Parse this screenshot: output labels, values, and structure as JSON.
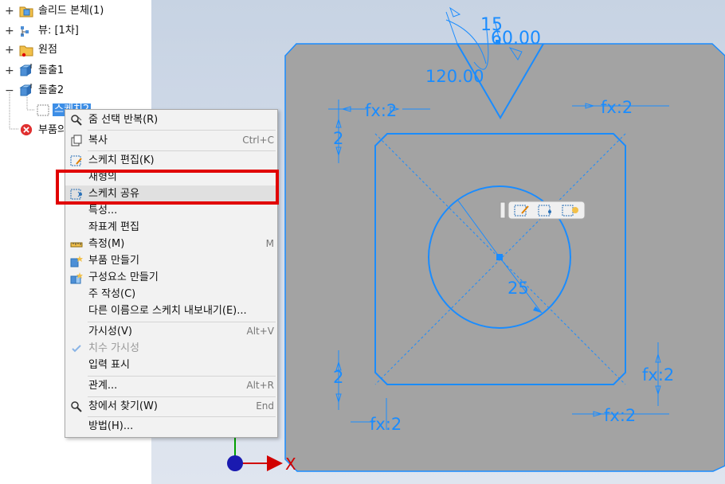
{
  "tree": {
    "items": [
      {
        "label": "솔리드 본체(1)",
        "expander": "+"
      },
      {
        "label": "뷰: [1차]",
        "expander": "+"
      },
      {
        "label": "원점",
        "expander": "+"
      },
      {
        "label": "돌출1",
        "expander": "+"
      },
      {
        "label": "돌출2",
        "expander": "−"
      },
      {
        "label": "스케치2",
        "expander": ""
      },
      {
        "label": "부품의 끝",
        "expander": ""
      }
    ]
  },
  "context_menu": {
    "items": [
      {
        "label": "줌 선택 반복(R)",
        "shortcut": "",
        "icon": "zoom-select-icon"
      },
      {
        "label": "복사",
        "shortcut": "Ctrl+C",
        "icon": "copy-icon"
      },
      {
        "label": "스케치 편집(K)",
        "shortcut": "",
        "icon": "edit-sketch-icon"
      },
      {
        "label": "새형의",
        "shortcut": "",
        "icon": ""
      },
      {
        "label": "스케치 공유",
        "shortcut": "",
        "icon": "share-sketch-icon"
      },
      {
        "label": "특성...",
        "shortcut": "",
        "icon": ""
      },
      {
        "label": "좌표계 편집",
        "shortcut": "",
        "icon": ""
      },
      {
        "label": "측정(M)",
        "shortcut": "M",
        "icon": "measure-icon"
      },
      {
        "label": "부품 만들기",
        "shortcut": "",
        "icon": "make-part-icon"
      },
      {
        "label": "구성요소 만들기",
        "shortcut": "",
        "icon": "make-component-icon"
      },
      {
        "label": "주 작성(C)",
        "shortcut": "",
        "icon": ""
      },
      {
        "label": "다른 이름으로 스케치 내보내기(E)...",
        "shortcut": "",
        "icon": ""
      },
      {
        "label": "가시성(V)",
        "shortcut": "Alt+V",
        "icon": ""
      },
      {
        "label": "치수 가시성",
        "shortcut": "",
        "icon": "check-icon"
      },
      {
        "label": "입력 표시",
        "shortcut": "",
        "icon": ""
      },
      {
        "label": "관계...",
        "shortcut": "Alt+R",
        "icon": ""
      },
      {
        "label": "창에서 찾기(W)",
        "shortcut": "End",
        "icon": "find-in-window-icon"
      },
      {
        "label": "방법(H)...",
        "shortcut": "",
        "icon": ""
      }
    ]
  },
  "sketch": {
    "dims": {
      "angle_small": "15",
      "width_top": "60.00",
      "angle_large": "120.00",
      "chamfer_tl_fx": "fx:2",
      "chamfer_tr_fx": "fx:2",
      "chamfer_bl_fx": "fx:2",
      "chamfer_br_fx_side": "fx:2",
      "chamfer_br_fx_bottom": "fx:2",
      "chamfer_tl_v": "2",
      "chamfer_bl_v": "2",
      "hole_radius": "25"
    },
    "axis_x_label": "X",
    "colors": {
      "sketch": "#1a8cff",
      "part": "#a3a3a3",
      "axis_x": "#d10000",
      "axis_origin": "#1a1ab0",
      "axis_y": "#00a000"
    }
  }
}
